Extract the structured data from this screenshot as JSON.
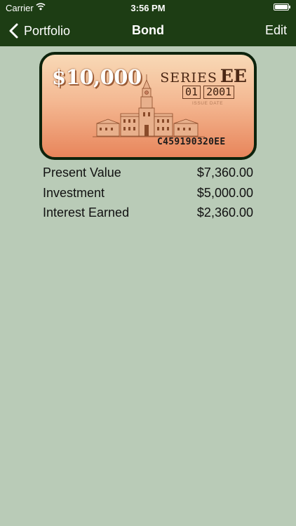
{
  "status_bar": {
    "carrier": "Carrier",
    "time": "3:56 PM"
  },
  "nav": {
    "back_label": "Portfolio",
    "title": "Bond",
    "edit_label": "Edit"
  },
  "bond": {
    "amount": "$10,000",
    "series_label": "SERIES",
    "series_code": "EE",
    "issue_month": "01",
    "issue_year": "2001",
    "issue_date_label": "ISSUE DATE",
    "serial": "C459190320EE"
  },
  "details": [
    {
      "label": "Present Value",
      "value": "$7,360.00"
    },
    {
      "label": "Investment",
      "value": "$5,000.00"
    },
    {
      "label": "Interest Earned",
      "value": "$2,360.00"
    }
  ],
  "colors": {
    "nav_background": "#1d3d14",
    "page_background": "#b9cbb7",
    "bond_border": "#0d230c"
  }
}
